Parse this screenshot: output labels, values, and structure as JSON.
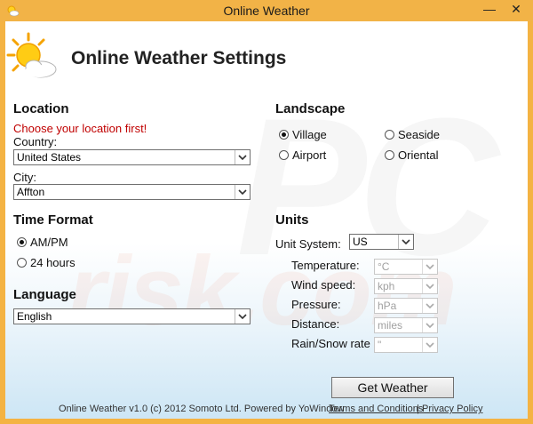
{
  "window": {
    "title": "Online Weather"
  },
  "titlebar": {
    "minimize": "—",
    "close": "✕"
  },
  "header": {
    "title": "Online Weather Settings"
  },
  "location": {
    "heading": "Location",
    "warning": "Choose your location first!",
    "country_label": "Country:",
    "country_value": "United States",
    "city_label": "City:",
    "city_value": "Affton"
  },
  "time_format": {
    "heading": "Time Format",
    "options": [
      "AM/PM",
      "24 hours"
    ],
    "selected": "AM/PM"
  },
  "language": {
    "heading": "Language",
    "value": "English"
  },
  "landscape": {
    "heading": "Landscape",
    "options": [
      "Village",
      "Seaside",
      "Airport",
      "Oriental"
    ],
    "selected": "Village"
  },
  "units": {
    "heading": "Units",
    "system_label": "Unit System:",
    "system_value": "US",
    "temperature_label": "Temperature:",
    "temperature_value": "°C",
    "wind_label": "Wind speed:",
    "wind_value": "kph",
    "pressure_label": "Pressure:",
    "pressure_value": "hPa",
    "distance_label": "Distance:",
    "distance_value": "miles",
    "rain_label": "Rain/Snow rate",
    "rain_value": "\""
  },
  "actions": {
    "get_weather": "Get Weather"
  },
  "footer": {
    "copyright": "Online Weather v1.0 (c) 2012 Somoto Ltd. Powered by YoWindow",
    "terms": "Terms and Conditions",
    "separator": "|",
    "privacy": "Privacy Policy"
  },
  "watermark": {
    "top": "PC",
    "bottom": "risk.com"
  }
}
